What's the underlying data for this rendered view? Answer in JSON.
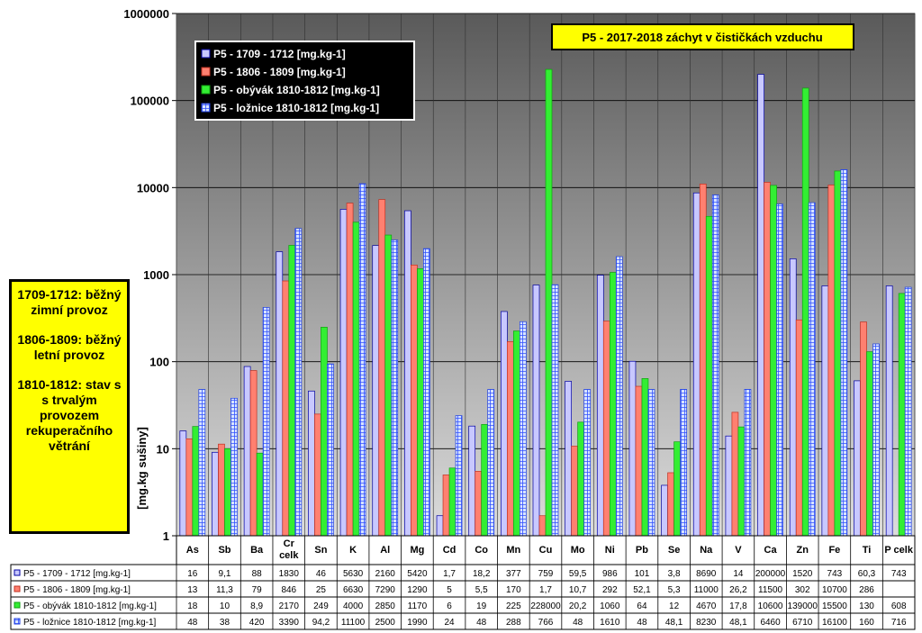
{
  "chart_data": {
    "type": "bar",
    "title": "P5 - 2017-2018 záchyt v čističkách vzduchu",
    "ylabel": "[mg.kg sušiny]",
    "yscale": "log",
    "ylim": [
      1,
      1000000
    ],
    "yticks": [
      "1",
      "10",
      "100",
      "1000",
      "10000",
      "100000",
      "1000000"
    ],
    "grid": true,
    "legend_position": "top-left",
    "categories": [
      "As",
      "Sb",
      "Ba",
      "Cr celk",
      "Sn",
      "K",
      "Al",
      "Mg",
      "Cd",
      "Co",
      "Mn",
      "Cu",
      "Mo",
      "Ni",
      "Pb",
      "Se",
      "Na",
      "V",
      "Ca",
      "Zn",
      "Fe",
      "Ti",
      "P celk"
    ],
    "series": [
      {
        "name": "P5 - 1709 - 1712  [mg.kg-1]",
        "table_name": "P5 - 1709 - 1712  [mg.kg-1]",
        "color": "#c8c8ff",
        "values": [
          16,
          9.1,
          88,
          1830,
          46,
          5630,
          2160,
          5420,
          1.7,
          18.2,
          377,
          759,
          59.5,
          986,
          101,
          3.8,
          8690,
          14,
          200000,
          1520,
          743,
          60.3,
          743
        ],
        "labels": [
          "16",
          "9,1",
          "88",
          "1830",
          "46",
          "5630",
          "2160",
          "5420",
          "1,7",
          "18,2",
          "377",
          "759",
          "59,5",
          "986",
          "101",
          "3,8",
          "8690",
          "14",
          "200000",
          "1520",
          "743",
          "60,3",
          "743"
        ]
      },
      {
        "name": "P5 - 1806 - 1809  [mg.kg-1]",
        "table_name": "P5 - 1806 - 1809  [mg.kg-1]",
        "color": "#ff8070",
        "values": [
          13,
          11.3,
          79,
          846,
          25,
          6630,
          7290,
          1290,
          5,
          5.5,
          170,
          1.7,
          10.7,
          292,
          52.1,
          5.3,
          11000,
          26.2,
          11500,
          302,
          10700,
          286,
          null
        ],
        "labels": [
          "13",
          "11,3",
          "79",
          "846",
          "25",
          "6630",
          "7290",
          "1290",
          "5",
          "5,5",
          "170",
          "1,7",
          "10,7",
          "292",
          "52,1",
          "5,3",
          "11000",
          "26,2",
          "11500",
          "302",
          "10700",
          "286",
          ""
        ]
      },
      {
        "name": "P5 - obývák  1810-1812 [mg.kg-1]",
        "table_name": "P5 - obývák  1810-1812 [mg.kg-1]",
        "color": "#33ee33",
        "values": [
          18,
          10,
          8.9,
          2170,
          249,
          4000,
          2850,
          1170,
          6,
          19,
          225,
          228000,
          20.2,
          1060,
          64,
          12,
          4670,
          17.8,
          10600,
          139000,
          15500,
          130,
          608
        ],
        "labels": [
          "18",
          "10",
          "8,9",
          "2170",
          "249",
          "4000",
          "2850",
          "1170",
          "6",
          "19",
          "225",
          "228000",
          "20,2",
          "1060",
          "64",
          "12",
          "4670",
          "17,8",
          "10600",
          "139000",
          "15500",
          "130",
          "608"
        ]
      },
      {
        "name": "P5 - ložnice 1810-1812 [mg.kg-1]",
        "table_name": "P5 - ložnice 1810-1812 [mg.kg-1]",
        "color": "#d8e4ff",
        "values": [
          48,
          38,
          420,
          3390,
          94.2,
          11100,
          2500,
          1990,
          24,
          48,
          288,
          766,
          48,
          1610,
          48,
          48.1,
          8230,
          48.1,
          6460,
          6710,
          16100,
          160,
          716
        ],
        "labels": [
          "48",
          "38",
          "420",
          "3390",
          "94,2",
          "11100",
          "2500",
          "1990",
          "24",
          "48",
          "288",
          "766",
          "48",
          "1610",
          "48",
          "48,1",
          "8230",
          "48,1",
          "6460",
          "6710",
          "16100",
          "160",
          "716"
        ]
      }
    ]
  },
  "note_box": {
    "line1": "1709-1712: běžný zimní provoz",
    "line2": "1806-1809: běžný letní provoz",
    "line3": "1810-1812: stav s s trvalým provozem rekuperačního větrání"
  }
}
